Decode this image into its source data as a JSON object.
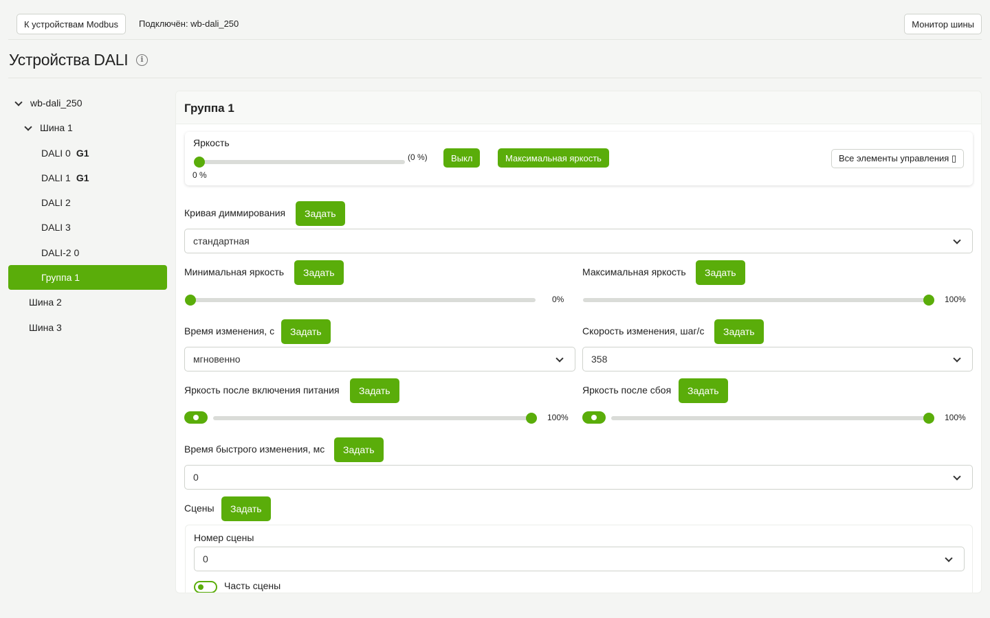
{
  "topbar": {
    "back_button": "К устройствам Modbus",
    "connected_label": "Подключён: wb-dali_250",
    "bus_monitor_button": "Монитор шины"
  },
  "page": {
    "title": "Устройства DALI",
    "info_icon": "info-icon"
  },
  "tree": {
    "root": "wb-dali_250",
    "bus1": "Шина 1",
    "items": [
      {
        "label": "DALI 0",
        "badge": "G1"
      },
      {
        "label": "DALI 1",
        "badge": "G1"
      },
      {
        "label": "DALI 2",
        "badge": ""
      },
      {
        "label": "DALI 3",
        "badge": ""
      },
      {
        "label": "DALI-2 0",
        "badge": ""
      },
      {
        "label": "Группа 1",
        "badge": ""
      }
    ],
    "bus2": "Шина 2",
    "bus3": "Шина 3"
  },
  "panel": {
    "title": "Группа 1",
    "brightness": {
      "label": "Яркость",
      "level_percent": 0,
      "value_text": "(0 %)",
      "below_text": "0 %",
      "off_button": "Выкл",
      "max_button": "Максимальная яркость",
      "all_controls_button": "Все элементы управления ▯"
    },
    "set_label": "Задать",
    "dimming_curve": {
      "label": "Кривая диммирования",
      "value": "стандартная"
    },
    "min_brightness": {
      "label": "Минимальная яркость",
      "level_percent": 0,
      "value_text": "0%"
    },
    "max_brightness": {
      "label": "Максимальная яркость",
      "level_percent": 100,
      "value_text": "100%"
    },
    "fade_time": {
      "label": "Время изменения, с",
      "value": "мгновенно"
    },
    "fade_rate": {
      "label": "Скорость изменения, шаг/с",
      "value": "358"
    },
    "power_on_level": {
      "label": "Яркость после включения питания",
      "enabled": true,
      "level_percent": 100,
      "value_text": "100%"
    },
    "failure_level": {
      "label": "Яркость после сбоя",
      "enabled": true,
      "level_percent": 100,
      "value_text": "100%"
    },
    "fast_fade_time": {
      "label": "Время быстрого изменения, мс",
      "value": "0"
    },
    "scenes": {
      "label": "Сцены",
      "scene_number_label": "Номер сцены",
      "scene_number_value": "0",
      "part_of_scene_label": "Часть сцены",
      "part_of_scene_enabled": false
    }
  },
  "colors": {
    "accent": "#5aad0a",
    "background": "#f4f5f3",
    "track": "#dadcd8"
  }
}
